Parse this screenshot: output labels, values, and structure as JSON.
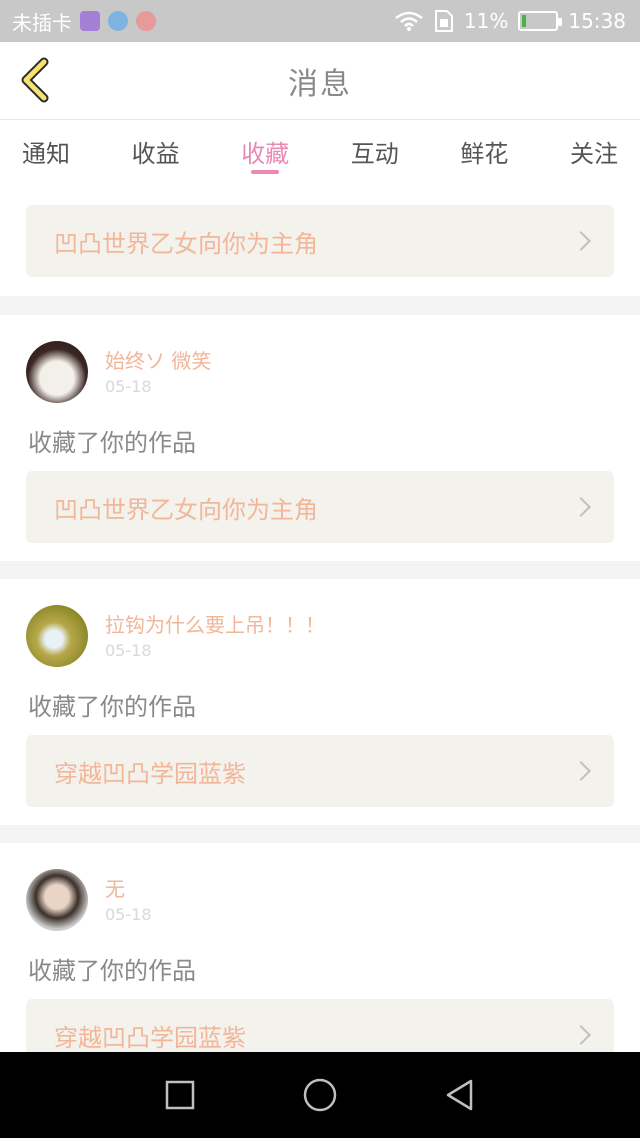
{
  "status_bar": {
    "carrier": "未插卡",
    "battery": "11%",
    "time": "15:38",
    "icons": [
      "gallery-icon",
      "app-icon",
      "app-icon",
      "wifi-icon",
      "sim-icon",
      "battery-icon"
    ],
    "battery_level": 0.11
  },
  "header": {
    "title": "消息",
    "back_icon": "chevron-left-icon"
  },
  "tabs": [
    {
      "label": "通知"
    },
    {
      "label": "收益"
    },
    {
      "label": "收藏"
    },
    {
      "label": "互动"
    },
    {
      "label": "鲜花"
    },
    {
      "label": "关注"
    }
  ],
  "active_tab": "收藏",
  "partial_top": {
    "work_title": "凹凸世界乙女向你为主角"
  },
  "cards": [
    {
      "user": "始终ソ 微笑",
      "date": "05-18",
      "action": "收藏了你的作品",
      "work_title": "凹凸世界乙女向你为主角"
    },
    {
      "user": "拉钩为什么要上吊！！！",
      "date": "05-18",
      "action": "收藏了你的作品",
      "work_title": "穿越凹凸学园蓝紫"
    },
    {
      "user": "无",
      "date": "05-18",
      "action": "收藏了你的作品",
      "work_title": "穿越凹凸学园蓝紫"
    }
  ],
  "colors": {
    "accent": "#ea89b3",
    "work_title": "#f2b699",
    "work_box_bg": "#f4f2ec"
  },
  "navbar": {
    "icons": [
      "recent-apps-icon",
      "home-icon",
      "back-icon"
    ]
  }
}
